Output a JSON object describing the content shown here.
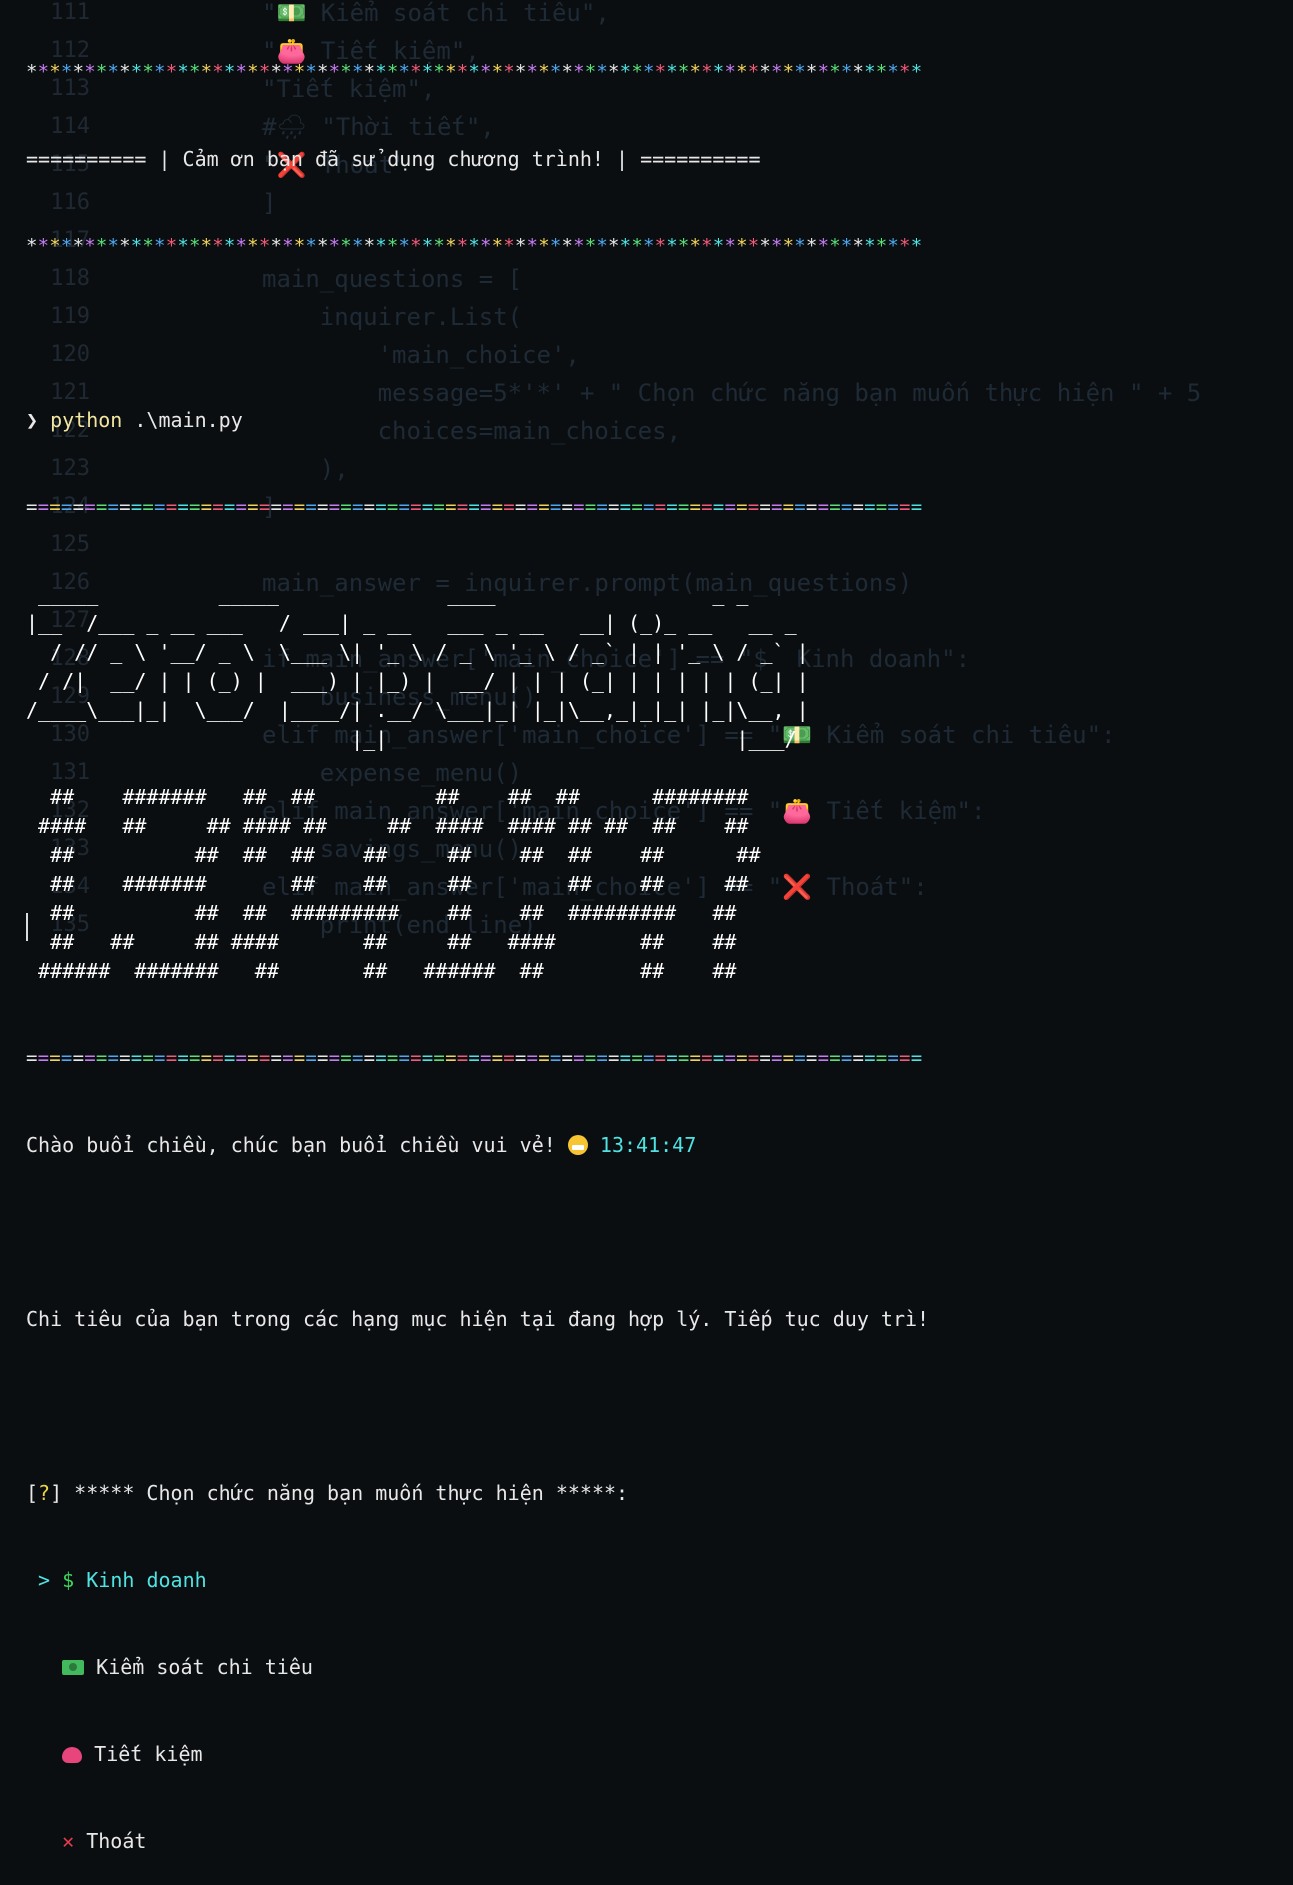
{
  "background_code": [
    {
      "ln": "111",
      "code": "\"💵 Kiểm soát chi tiêu\","
    },
    {
      "ln": "112",
      "code": "\"👛 Tiết kiệm\","
    },
    {
      "ln": "113",
      "code": "\"Tiết kiệm\","
    },
    {
      "ln": "114",
      "code": "#🌧 \"Thời tiết\","
    },
    {
      "ln": "115",
      "code": "\"❌ Thoát\""
    },
    {
      "ln": "116",
      "code": "]"
    },
    {
      "ln": "117",
      "code": ""
    },
    {
      "ln": "118",
      "code": "main_questions = ["
    },
    {
      "ln": "119",
      "code": "    inquirer.List("
    },
    {
      "ln": "120",
      "code": "        'main_choice',"
    },
    {
      "ln": "121",
      "code": "        message=5*'*' + \" Chọn chức năng bạn muốn thực hiện \" + 5"
    },
    {
      "ln": "122",
      "code": "        choices=main_choices,"
    },
    {
      "ln": "123",
      "code": "    ),"
    },
    {
      "ln": "124",
      "code": "]"
    },
    {
      "ln": "125",
      "code": ""
    },
    {
      "ln": "126",
      "code": "main_answer = inquirer.prompt(main_questions)"
    },
    {
      "ln": "127",
      "code": ""
    },
    {
      "ln": "128",
      "code": "if main_answer['main_choice'] == \"$  Kinh doanh\":"
    },
    {
      "ln": "129",
      "code": "    business_menu()"
    },
    {
      "ln": "130",
      "code": "elif main_answer['main_choice'] == \"💵 Kiểm soát chi tiêu\":"
    },
    {
      "ln": "131",
      "code": "    expense_menu()"
    },
    {
      "ln": "132",
      "code": "elif main_answer['main_choice'] == \"👛 Tiết kiệm\":"
    },
    {
      "ln": "133",
      "code": "    savings_menu()"
    },
    {
      "ln": "134",
      "code": "elif main_answer['main_choice'] == \"❌ Thoát\":"
    },
    {
      "ln": "135",
      "code": "    print(end_line)"
    }
  ],
  "terminal": {
    "star_line": "*****************************************************************************",
    "thanks_line": "========== | Cảm ơn bạn đã sử dụng chương trình! | ==========",
    "prompt_symbol": "❯",
    "command": "python",
    "command_args": " .\\main.py",
    "equals_line": "=============================================================================",
    "ascii_art": [
      " _____          _____              ____                  _ _",
      "|__  /___ _ __ ___   / ___| _ __   ___ _ __   __| (_)_ __   __ _",
      "  / // _ \\ '__/ _ \\  \\___ \\| '_ \\ / _ \\ '_ \\ / _` | | '_ \\ / _` |",
      " / /|  __/ | | (_) |  ___) | |_) |  __/ | | | (_| | | | | | (_| |",
      "/____\\___|_|  \\___/  |____/| .__/ \\___|_| |_|\\__,_|_|_| |_|\\__, |",
      "                           |_|                             |___/",
      "",
      "  ##    #######   ##  ##          ##    ##  ##      ########",
      " ####   ##     ## #### ##     ##  ####  #### ## ##  ##    ##",
      "  ##          ##  ##  ##    ##     ##    ##  ##    ##      ##",
      "  ##    #######       ##    ##     ##        ##    ##     ##",
      "  ##          ##  ##  #########    ##    ##  #########   ##",
      "  ##   ##     ## ####       ##     ##   ####       ##    ##",
      " ######  #######   ##       ##   ######  ##        ##    ##"
    ],
    "greeting": "Chào buổi chiều, chúc bạn buổi chiều vui vẻ!",
    "time": "13:41:47",
    "status_message": "Chi tiêu của bạn trong các hạng mục hiện tại đang hợp lý. Tiếp tục duy trì!",
    "question_mark": "?",
    "question_text": " ***** Chọn chức năng bạn muốn thực hiện *****:",
    "selector": ">",
    "menu": [
      {
        "icon": "dollar-icon",
        "icon_text": "$",
        "label": "Kinh doanh"
      },
      {
        "icon": "cash-icon",
        "label": "Kiểm soát chi tiêu"
      },
      {
        "icon": "purse-icon",
        "label": "Tiết kiệm"
      },
      {
        "icon": "cross-icon",
        "icon_text": "✕",
        "label": "Thoát"
      }
    ]
  },
  "colors": {
    "background": "#0b0e11",
    "selected": "#4fe3e3",
    "question_mark": "#e8d447",
    "command": "#f2e6a0",
    "dollar": "#3bd65c",
    "cross": "#e83c4f"
  }
}
